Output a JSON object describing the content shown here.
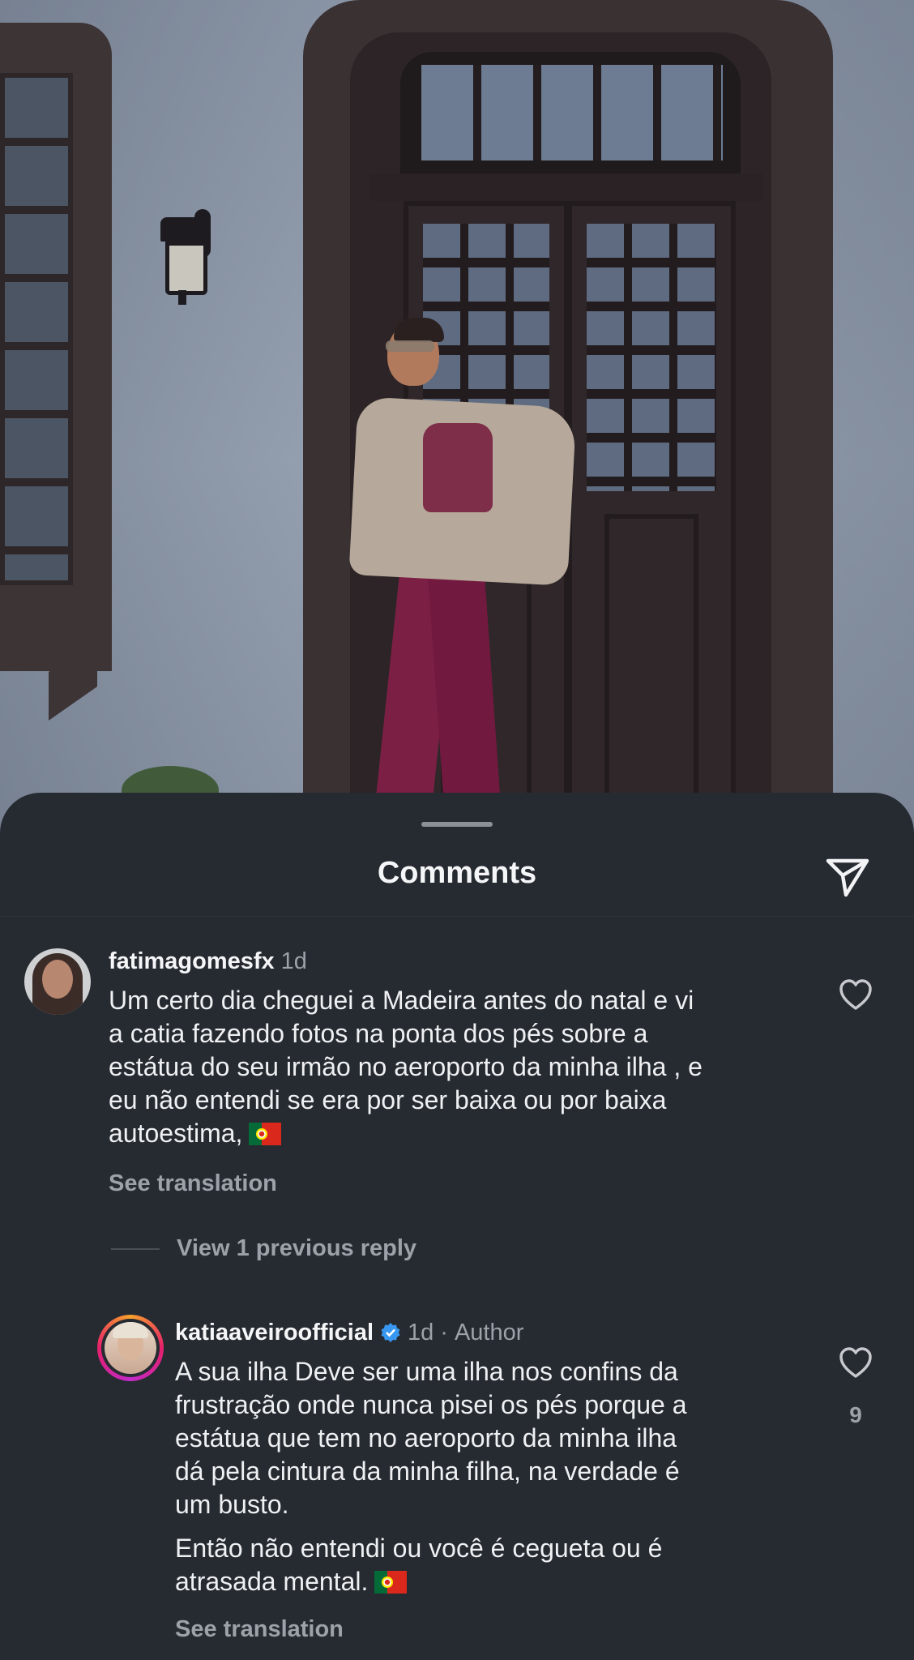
{
  "sheet": {
    "title": "Comments",
    "share_icon": "paper-plane-icon"
  },
  "comments": [
    {
      "username": "fatimagomesfx",
      "time": "1d",
      "lines": [
        "Um certo dia cheguei a Madeira antes do natal e vi",
        "a catia fazendo fotos na ponta dos pés sobre a",
        "estátua do seu irmão no aeroporto da minha ilha , e",
        "eu não entendi se era por ser baixa ou por baixa",
        "autoestima,"
      ],
      "emoji": "portugal-flag",
      "see_translation": "See translation",
      "view_replies": "View 1 previous reply",
      "like_icon": "heart-outline-icon"
    },
    {
      "username": "katiaaveiroofficial",
      "verified": true,
      "time": "1d",
      "separator": "·",
      "author_label": "Author",
      "lines": [
        "A sua ilha Deve ser uma ilha nos confins da",
        "frustração  onde nunca pisei os pés porque a",
        "estátua que tem no aeroporto da minha ilha",
        "dá pela cintura da minha filha, na verdade é",
        "um busto."
      ],
      "lines2": [
        "Então não entendi ou você é cegueta ou é",
        "atrasada mental."
      ],
      "emoji": "portugal-flag",
      "see_translation": "See translation",
      "like_count": "9",
      "like_icon": "heart-outline-icon"
    }
  ]
}
